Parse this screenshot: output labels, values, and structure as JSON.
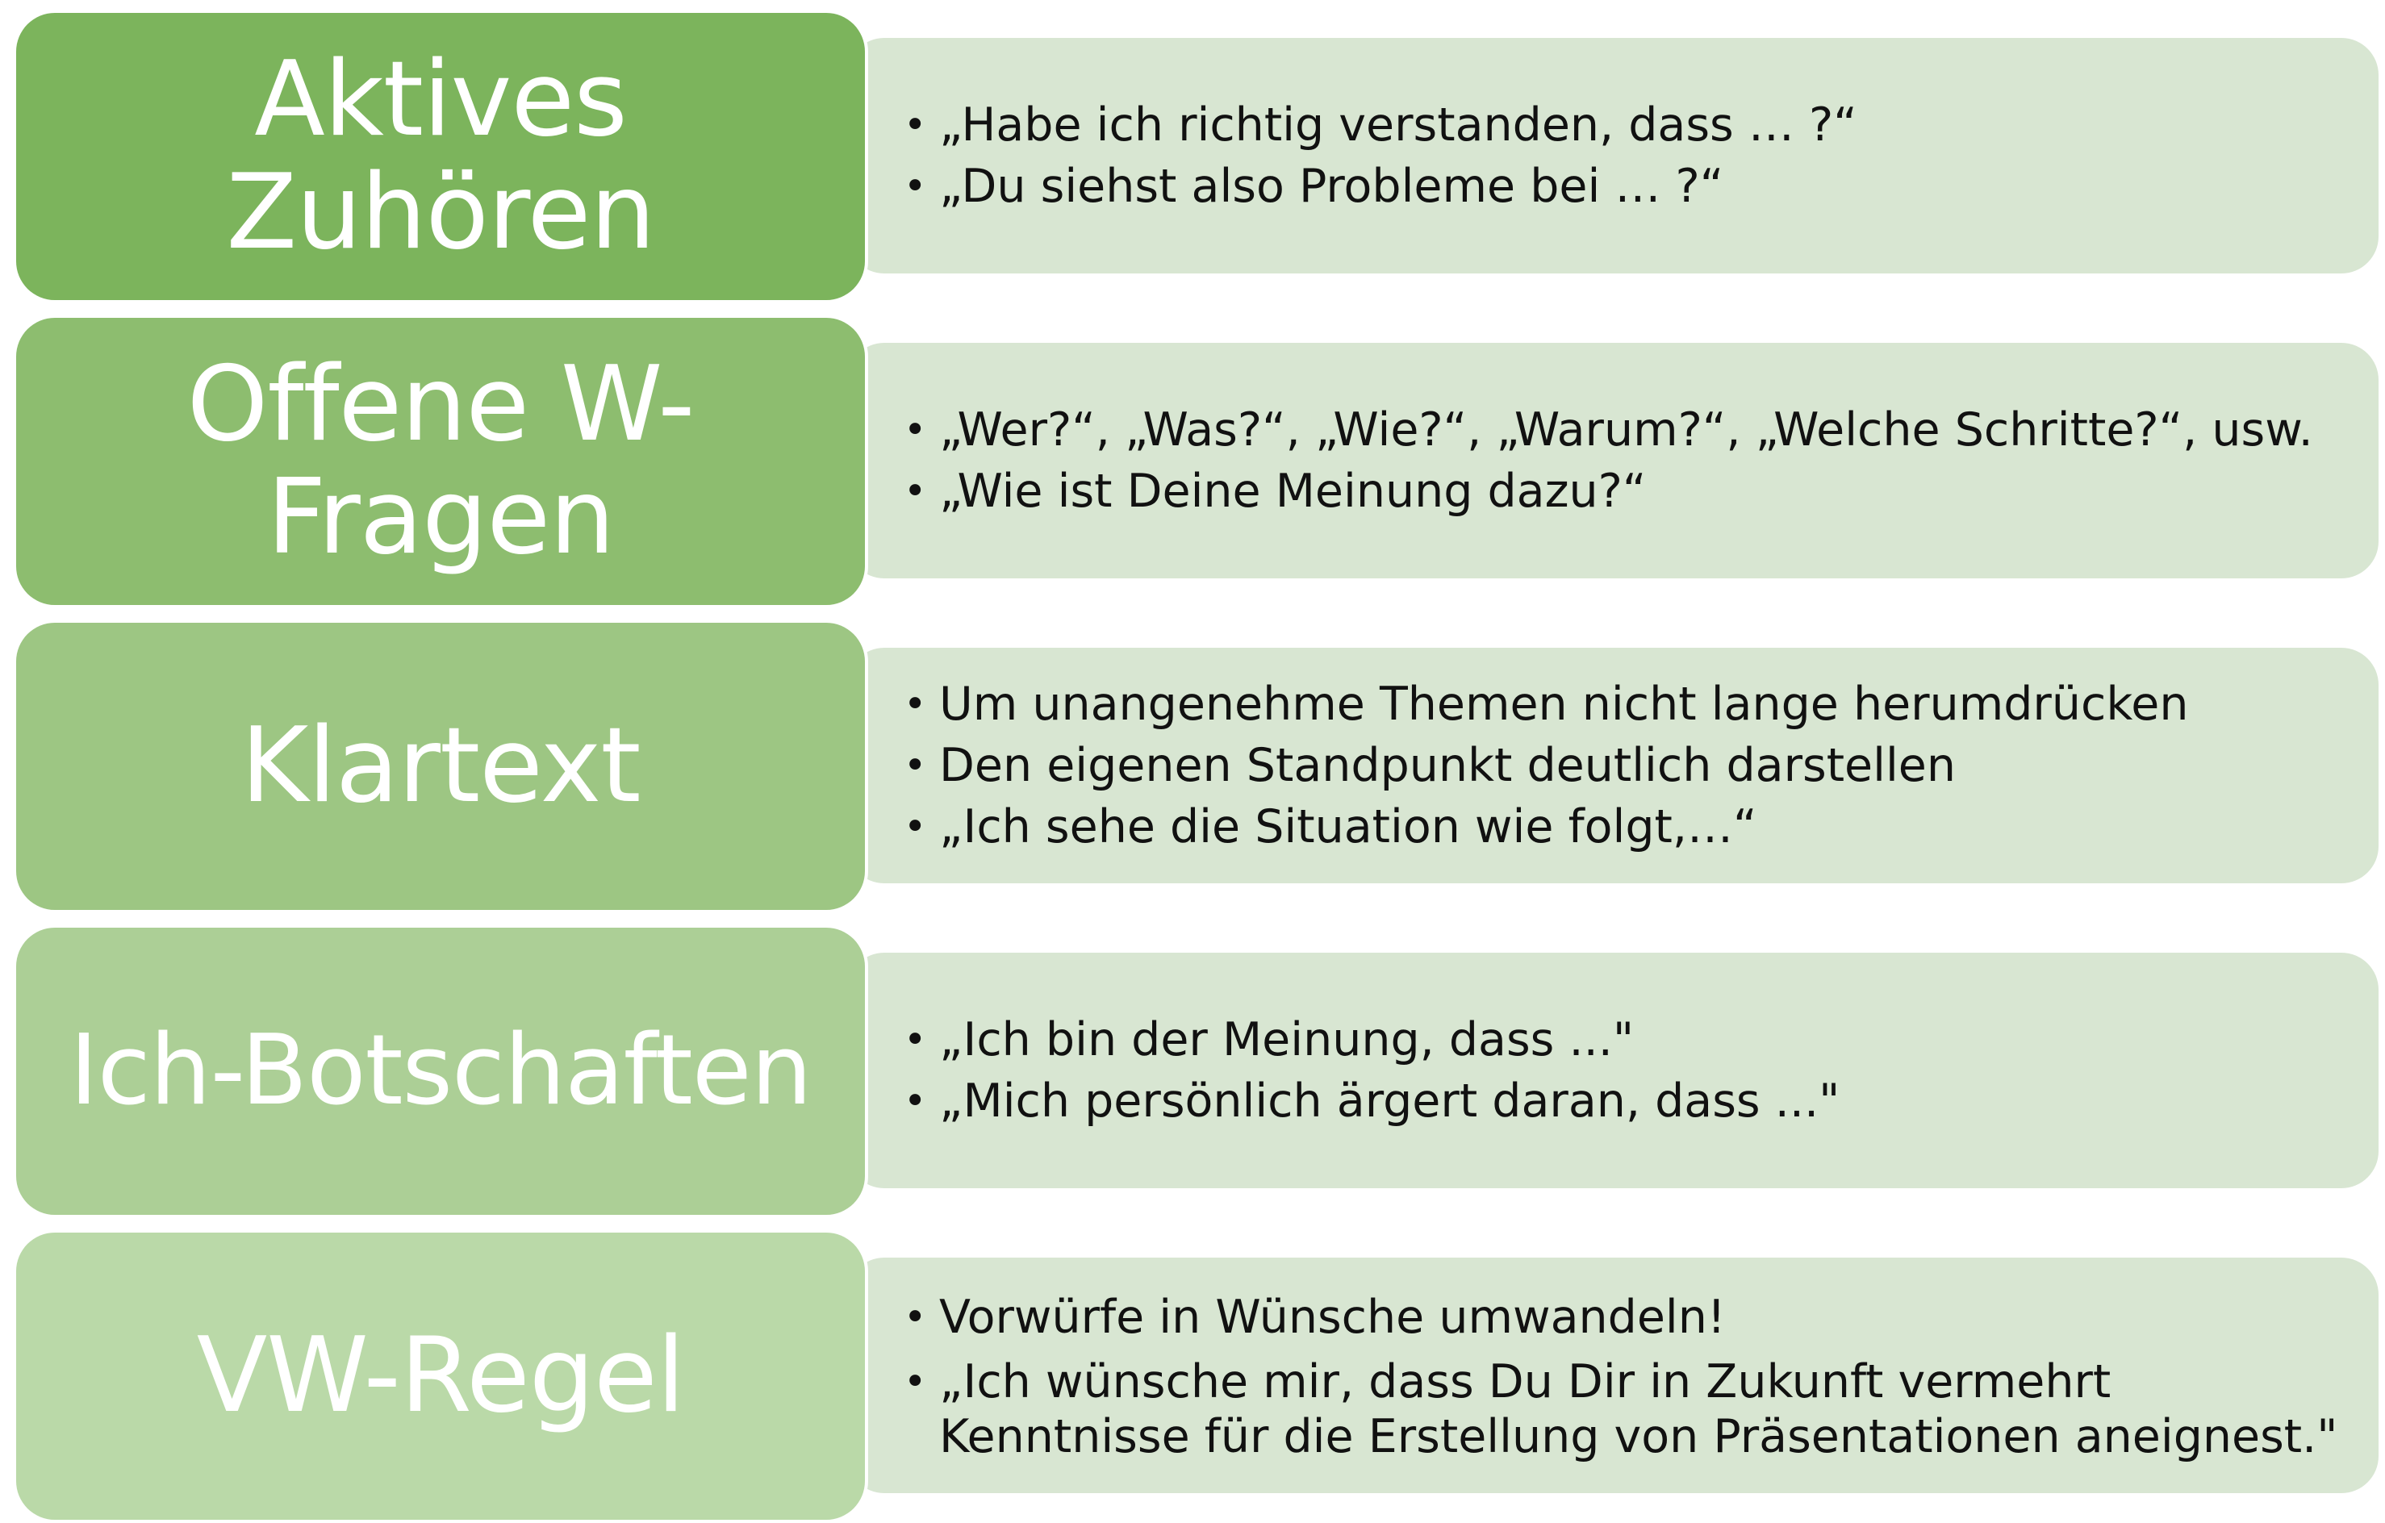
{
  "rows": [
    {
      "label": "Aktives Zuhören",
      "color": "#7cb45c",
      "bullets": [
        "„Habe ich richtig verstanden, dass … ?“",
        "„Du siehst also Probleme bei … ?“"
      ]
    },
    {
      "label": "Offene W-Fragen",
      "color": "#8dbd6f",
      "bullets": [
        "„Wer?“, „Was?“, „Wie?“, „Warum?“, „Welche Schritte?“, usw.",
        "„Wie ist Deine Meinung dazu?“"
      ]
    },
    {
      "label": "Klartext",
      "color": "#9dc683",
      "bullets": [
        "Um unangenehme Themen nicht lange herumdrücken",
        "Den eigenen Standpunkt deutlich darstellen",
        "„Ich sehe die Situation wie folgt,…“"
      ]
    },
    {
      "label": "Ich-Botschaften",
      "color": "#accf96",
      "bullets": [
        "„Ich bin der Meinung, dass ...\"",
        "„Mich persönlich ärgert daran, dass ...\""
      ]
    },
    {
      "label": "VW-Regel",
      "color": "#bad9a8",
      "bullets": [
        "Vorwürfe in Wünsche umwandeln!",
        "„Ich wünsche mir, dass Du Dir in Zukunft vermehrt Kenntnisse für die Erstellung von Präsentationen aneignest.\""
      ]
    }
  ]
}
